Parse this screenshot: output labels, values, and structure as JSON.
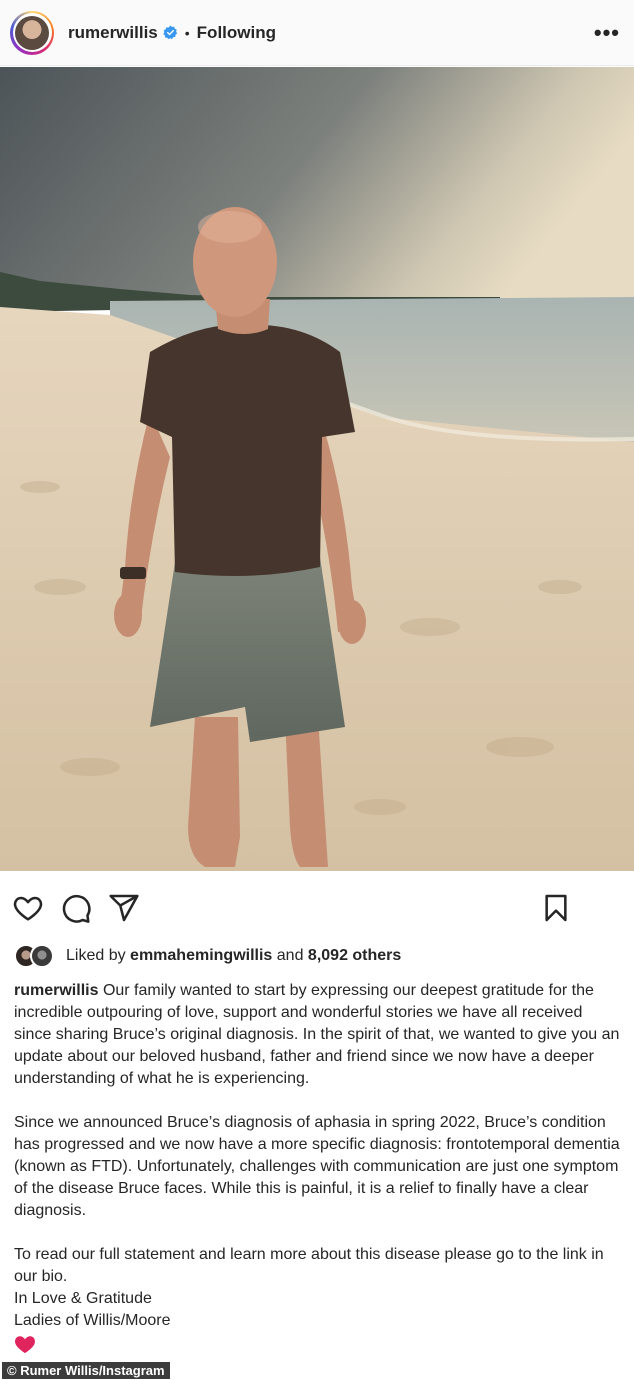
{
  "header": {
    "username": "rumerwillis",
    "separator": "•",
    "follow_status": "Following",
    "more_glyph": "•••"
  },
  "icons": {
    "like": "heart-outline-icon",
    "comment": "comment-bubble-icon",
    "share": "paper-plane-icon",
    "save": "bookmark-icon",
    "verified": "verified-badge-icon",
    "caption_end": "red-heart-emoji"
  },
  "likes": {
    "prefix": "Liked by",
    "user": "emmahemingwillis",
    "connector": "and",
    "others": "8,092 others"
  },
  "caption": {
    "username": "rumerwillis",
    "paragraph1": "Our family wanted to start by expressing our deepest gratitude for the incredible outpouring of love, support and wonderful stories we have all received since sharing Bruce’s original diagnosis. In the spirit of that, we wanted to give you an update about our beloved husband, father and friend since we now have a deeper understanding of what he is experiencing.",
    "paragraph2": "Since we announced Bruce’s diagnosis of aphasia in spring 2022, Bruce’s condition has progressed and we now have a more specific diagnosis: frontotemporal dementia (known as FTD). Unfortunately, challenges with communication are just one symptom of the disease Bruce faces. While this is painful, it is a relief to finally have a clear diagnosis.",
    "paragraph3": "To read our full statement and learn more about this disease please go to the link in our bio.",
    "signoff1": "In Love & Gratitude",
    "signoff2": "Ladies of Willis/Moore"
  },
  "credit": "© Rumer Willis/Instagram",
  "colors": {
    "verified_blue": "#3897f0",
    "heart_red": "#e0245e",
    "text": "#262626"
  }
}
